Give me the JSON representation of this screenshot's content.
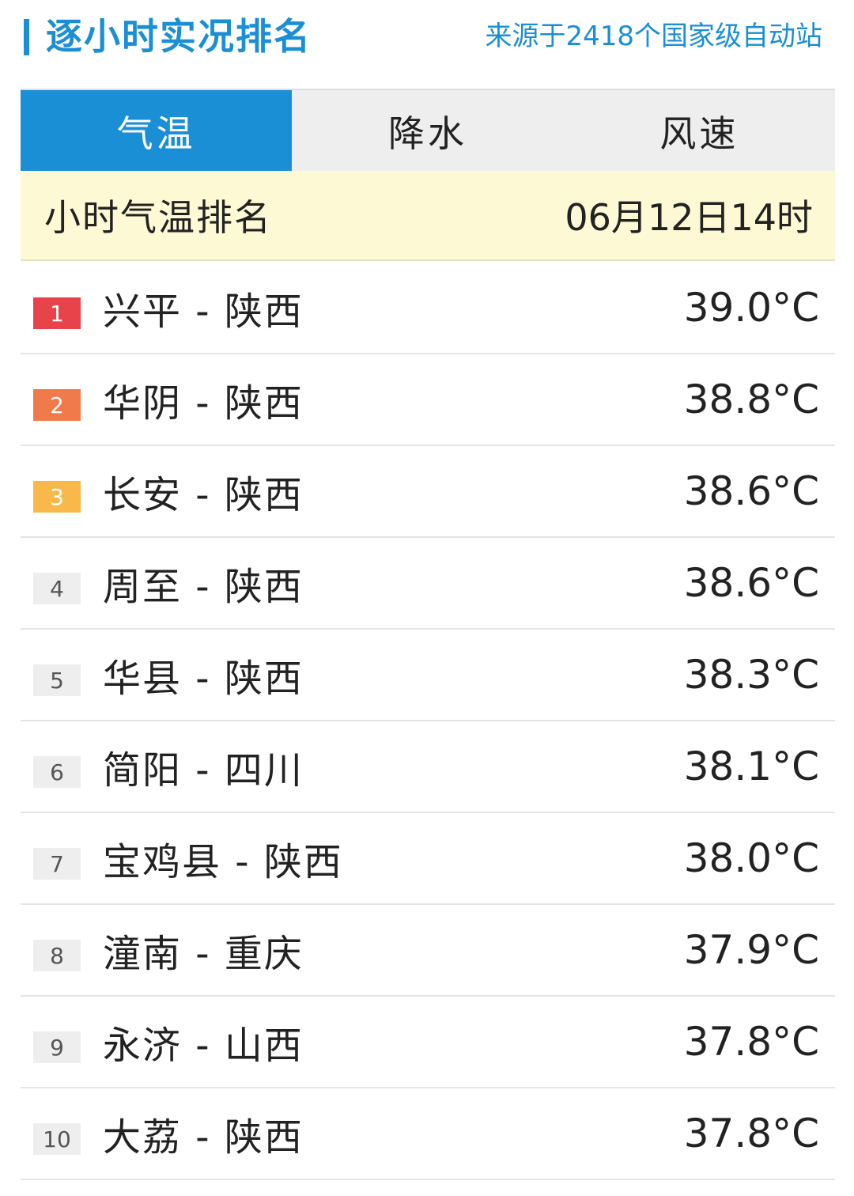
{
  "header": {
    "title": "逐小时实况排名",
    "source": "来源于2418个国家级自动站"
  },
  "tabs": [
    {
      "label": "气温",
      "active": true
    },
    {
      "label": "降水",
      "active": false
    },
    {
      "label": "风速",
      "active": false
    }
  ],
  "subheader": {
    "label": "小时气温排名",
    "time": "06月12日14时"
  },
  "rows": [
    {
      "rank": "1",
      "station": "兴平 - 陕西",
      "temp": "39.0°C"
    },
    {
      "rank": "2",
      "station": "华阴 - 陕西",
      "temp": "38.8°C"
    },
    {
      "rank": "3",
      "station": "长安 - 陕西",
      "temp": "38.6°C"
    },
    {
      "rank": "4",
      "station": "周至 - 陕西",
      "temp": "38.6°C"
    },
    {
      "rank": "5",
      "station": "华县 - 陕西",
      "temp": "38.3°C"
    },
    {
      "rank": "6",
      "station": "简阳 - 四川",
      "temp": "38.1°C"
    },
    {
      "rank": "7",
      "station": "宝鸡县 - 陕西",
      "temp": "38.0°C"
    },
    {
      "rank": "8",
      "station": "潼南 - 重庆",
      "temp": "37.9°C"
    },
    {
      "rank": "9",
      "station": "永济 - 山西",
      "temp": "37.8°C"
    },
    {
      "rank": "10",
      "station": "大荔 - 陕西",
      "temp": "37.8°C"
    }
  ],
  "colors": {
    "accent": "#1a8fd6",
    "rank1": "#e8434a",
    "rank2": "#f07a4a",
    "rank3": "#f8b84a",
    "subheader_bg": "#fdf9d4"
  }
}
